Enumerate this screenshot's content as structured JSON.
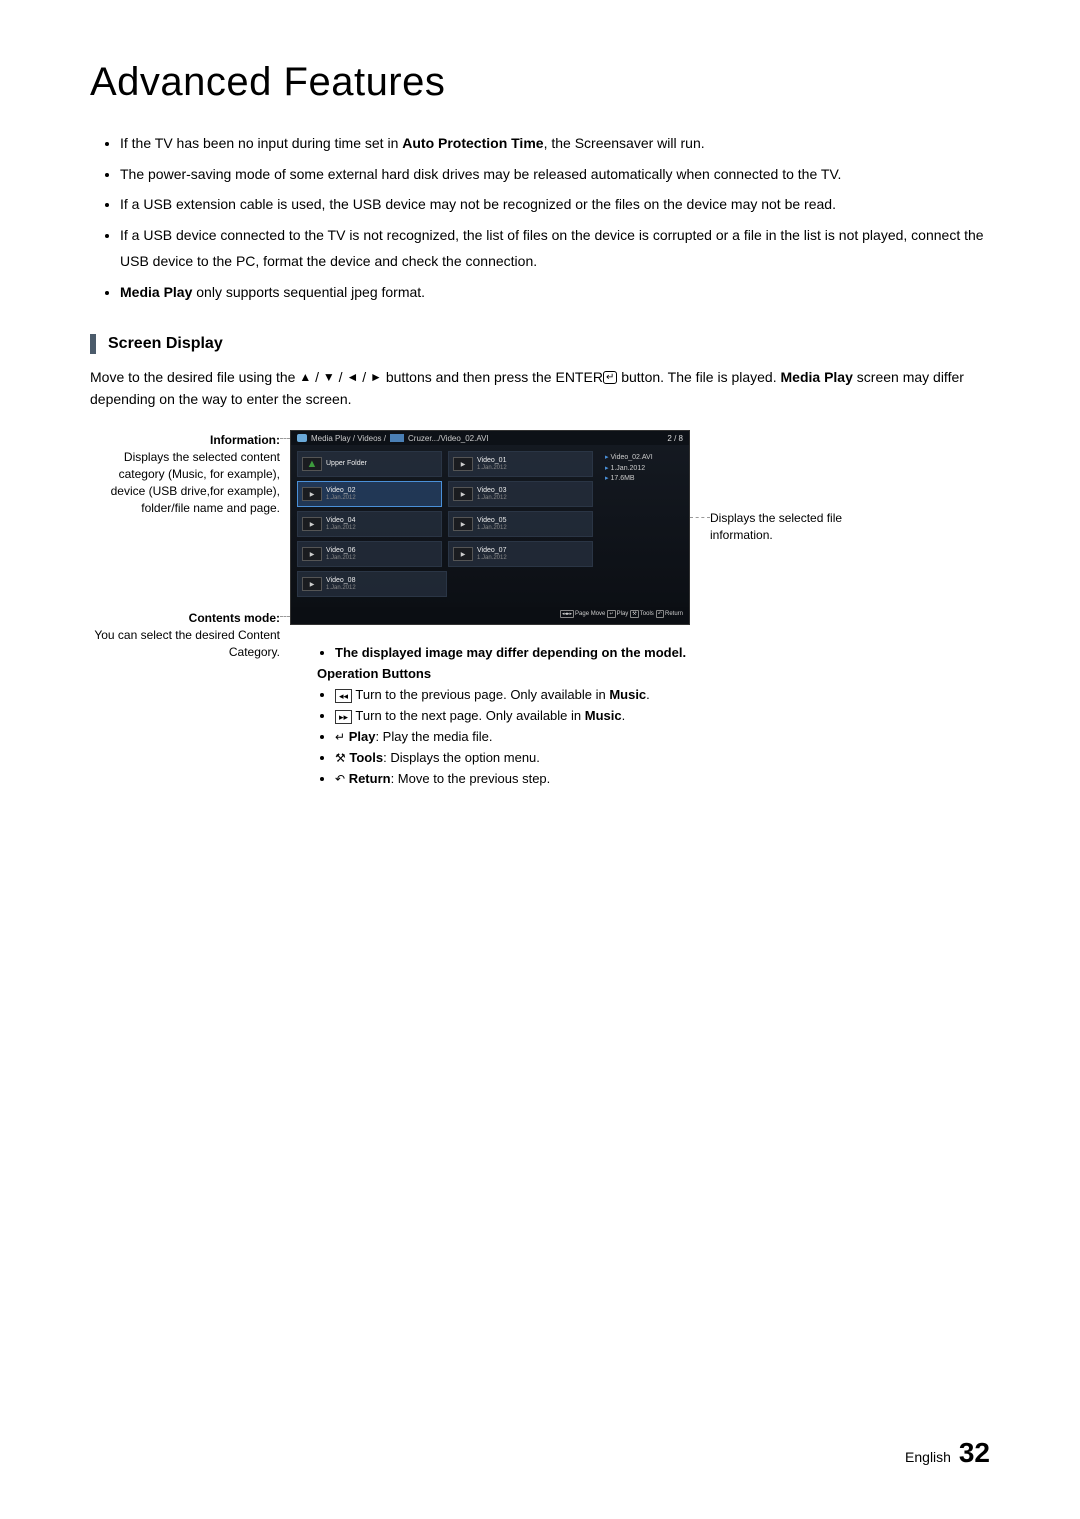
{
  "title": "Advanced Features",
  "intro_bullets": {
    "b1_pre": "If the TV has been no input during time set in ",
    "b1_bold": "Auto Protection Time",
    "b1_post": ", the Screensaver will run.",
    "b2": "The power-saving mode of some external hard disk drives may be released automatically when connected to the TV.",
    "b3": "If a USB extension cable is used, the USB device may not be recognized or the files on the device may not be read.",
    "b4": "If a USB device connected to the TV is not recognized, the list of files on the device is corrupted or a file in the list is not played, connect the USB device to the PC, format the device and check the connection.",
    "b5_bold": "Media Play",
    "b5_post": " only supports sequential jpeg format."
  },
  "section": {
    "title": "Screen Display",
    "desc_pre": "Move to the desired file using the ",
    "desc_mid": " buttons and then press the ENTER",
    "desc_post": " button. The file is played. ",
    "desc_bold": "Media Play",
    "desc_end": " screen may differ depending on the way to enter the screen."
  },
  "callouts": {
    "info_title": "Information:",
    "info_body": "Displays the selected content category (Music, for example), device (USB drive,for example), folder/file name and page.",
    "contents_title": "Contents mode:",
    "contents_body": "You can select the desired Content Category.",
    "right_body": "Displays the selected file information."
  },
  "tv": {
    "breadcrumb_prefix": "Media Play / Videos / ",
    "breadcrumb_suffix": " Cruzer.../Video_02.AVI",
    "page_indicator": "2 / 8",
    "upper_folder": "Upper Folder",
    "tiles": [
      {
        "name": "Video_01",
        "date": "1.Jan.2012"
      },
      {
        "name": "Video_02",
        "date": "1.Jan.2012",
        "selected": true
      },
      {
        "name": "Video_03",
        "date": "1.Jan.2012"
      },
      {
        "name": "Video_04",
        "date": "1.Jan.2012"
      },
      {
        "name": "Video_05",
        "date": "1.Jan.2012"
      },
      {
        "name": "Video_06",
        "date": "1.Jan.2012"
      },
      {
        "name": "Video_07",
        "date": "1.Jan.2012"
      },
      {
        "name": "Video_08",
        "date": "1.Jan.2012"
      }
    ],
    "side": {
      "name": "Video_02.AVI",
      "date": "1.Jan.2012",
      "size": "17.6MB"
    },
    "footer": {
      "page_move": "Page Move",
      "play": "Play",
      "tools": "Tools",
      "return": "Return"
    }
  },
  "op": {
    "note_bullet_pre": "The displayed image may differ depending on the model.",
    "heading": "Operation Buttons",
    "prev_post": " Turn to the previous page. Only available in ",
    "prev_bold": "Music",
    "next_post": " Turn to the next page. Only available in ",
    "next_bold": "Music",
    "play_bold": "Play",
    "play_post": ": Play the media file.",
    "tools_bold": "Tools",
    "tools_post": ": Displays the option menu.",
    "return_bold": "Return",
    "return_post": ": Move to the previous step."
  },
  "footer": {
    "lang": "English",
    "page": "32"
  }
}
